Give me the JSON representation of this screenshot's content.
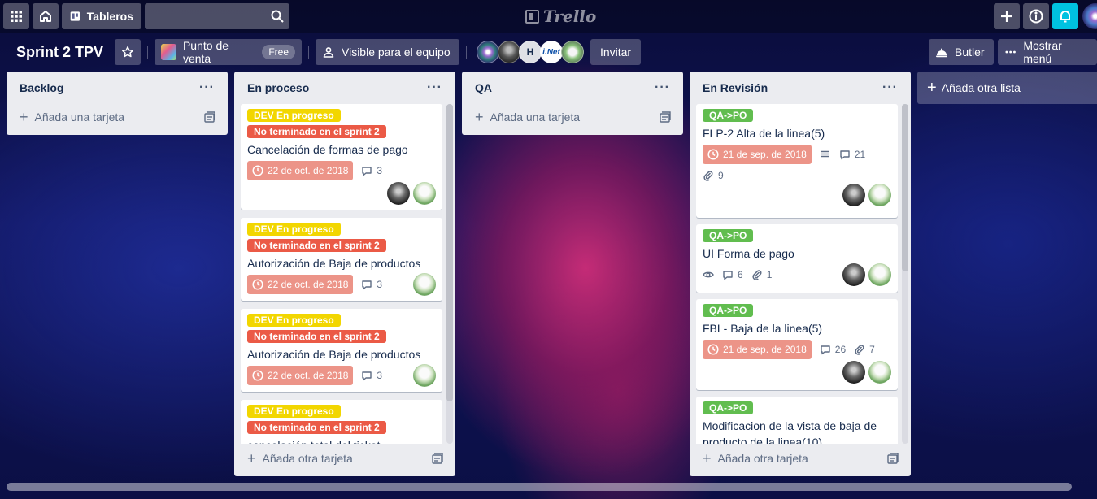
{
  "topnav": {
    "boards_label": "Tableros",
    "search_value": "",
    "logo_text": "Trello",
    "icons": [
      "apps-grid-icon",
      "home-icon",
      "board-icon",
      "search-icon",
      "plus-icon",
      "info-icon",
      "bell-icon"
    ]
  },
  "board": {
    "title": "Sprint 2 TPV",
    "team_name": "Punto de venta",
    "team_badge": "Free",
    "visibility": "Visible para el equipo",
    "member_initial": "H",
    "member_logo_text": "i.Net",
    "invite_label": "Invitar",
    "butler_label": "Butler",
    "menu_label": "Mostrar menú"
  },
  "colors": {
    "label_yellow": "#f2d600",
    "label_red": "#eb5a46",
    "label_green": "#61bd4f",
    "due_overdue": "#ec9488",
    "notification_accent": "#00c2e0"
  },
  "lists": [
    {
      "name": "Backlog",
      "add_label": "Añada una tarjeta",
      "cards": []
    },
    {
      "name": "En proceso",
      "add_label": "Añada otra tarjeta",
      "cards": [
        {
          "labels": [
            "DEV En progreso",
            "No terminado en el sprint 2"
          ],
          "title": "Cancelación de formas de pago",
          "due": "22 de oct. de 2018",
          "comments": "3"
        },
        {
          "labels": [
            "DEV En progreso",
            "No terminado en el sprint 2"
          ],
          "title": "Autorización de Baja de productos",
          "due": "22 de oct. de 2018",
          "comments": "3"
        },
        {
          "labels": [
            "DEV En progreso",
            "No terminado en el sprint 2"
          ],
          "title": "Autorización de Baja de productos",
          "due": "22 de oct. de 2018",
          "comments": "3"
        },
        {
          "labels": [
            "DEV En progreso",
            "No terminado en el sprint 2"
          ],
          "title": "cancelación total del ticket"
        }
      ]
    },
    {
      "name": "QA",
      "add_label": "Añada una tarjeta",
      "cards": []
    },
    {
      "name": "En Revisión",
      "add_label": "Añada otra tarjeta",
      "cards": [
        {
          "labels": [
            "QA->PO"
          ],
          "title": "FLP-2 Alta de la linea(5)",
          "due": "21 de sep. de 2018",
          "comments": "21",
          "attachments": "9"
        },
        {
          "labels": [
            "QA->PO"
          ],
          "title": "UI Forma de pago",
          "comments": "6",
          "attachments": "1"
        },
        {
          "labels": [
            "QA->PO"
          ],
          "title": "FBL- Baja de la linea(5)",
          "due": "21 de sep. de 2018",
          "comments": "26",
          "attachments": "7"
        },
        {
          "labels": [
            "QA->PO"
          ],
          "title": "Modificacion de la vista de baja de producto de la linea(10)"
        }
      ]
    }
  ],
  "add_list_label": "Añada otra lista"
}
